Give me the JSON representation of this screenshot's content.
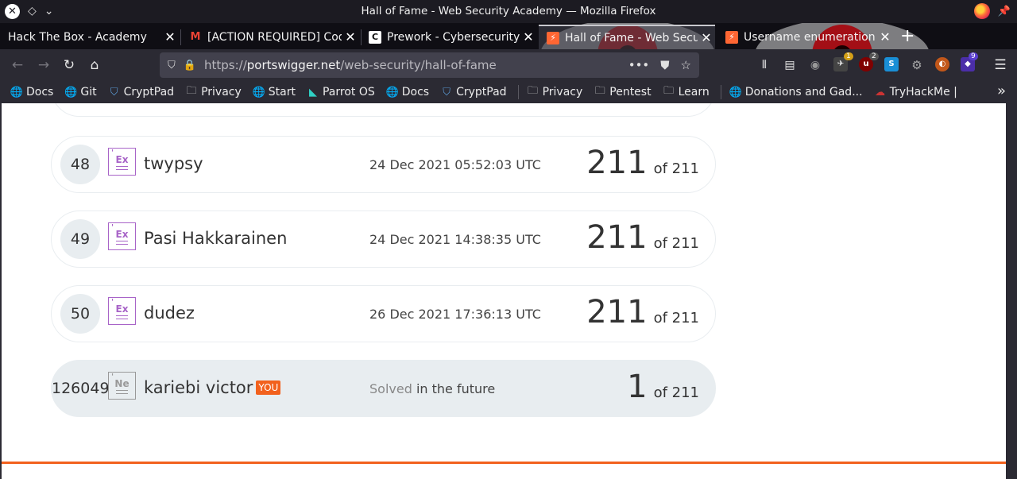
{
  "window": {
    "title": "Hall of Fame - Web Security Academy — Mozilla Firefox",
    "left_glyphs": [
      "◇",
      "⌄"
    ]
  },
  "tabs": [
    {
      "label": "Hack The Box - Academy",
      "favicon": "none"
    },
    {
      "label": "[ACTION REQUIRED] Code",
      "favicon": "gmail-icon"
    },
    {
      "label": "Prework - Cybersecurity",
      "favicon": "codepath-icon"
    },
    {
      "label": "Hall of Fame - Web Secu",
      "favicon": "portswigger-icon",
      "active": true
    },
    {
      "label": "Username enumeration",
      "favicon": "portswigger-icon"
    }
  ],
  "nav": {
    "url_prefix": "https://",
    "url_domain": "portswigger.net",
    "url_path": "/web-security/hall-of-fame",
    "more_glyph": "•••",
    "extension_badges": {
      "a": "1",
      "b": "2",
      "c": "9"
    }
  },
  "bookmarks": [
    {
      "label": "Docs",
      "icon": "globe-icon"
    },
    {
      "label": "Git",
      "icon": "globe-icon"
    },
    {
      "label": "CryptPad",
      "icon": "shield-icon"
    },
    {
      "label": "Privacy",
      "icon": "folder-icon"
    },
    {
      "label": "Start",
      "icon": "globe-icon"
    },
    {
      "label": "Parrot OS",
      "icon": "parrot-icon"
    },
    {
      "label": "Docs",
      "icon": "globe-icon"
    },
    {
      "label": "CryptPad",
      "icon": "shield-icon"
    },
    {
      "label": "Privacy",
      "icon": "folder-icon"
    },
    {
      "label": "Pentest",
      "icon": "folder-icon"
    },
    {
      "label": "Learn",
      "icon": "folder-icon"
    },
    {
      "label": "Donations and Gad...",
      "icon": "globe-icon"
    },
    {
      "label": "TryHackMe |",
      "icon": "tryhackme-icon"
    }
  ],
  "leaderboard": {
    "rows": [
      {
        "rank": "48",
        "badge": "Ex",
        "name": "twypsy",
        "date": "24 Dec 2021 05:52:03 UTC",
        "score": "211",
        "of": "of 211"
      },
      {
        "rank": "49",
        "badge": "Ex",
        "name": "Pasi Hakkarainen",
        "date": "24 Dec 2021 14:38:35 UTC",
        "score": "211",
        "of": "of 211"
      },
      {
        "rank": "50",
        "badge": "Ex",
        "name": "dudez",
        "date": "26 Dec 2021 17:36:13 UTC",
        "score": "211",
        "of": "of 211"
      }
    ],
    "you": {
      "rank": "126049",
      "badge": "Ne",
      "name": "kariebi victor",
      "tag": "YOU",
      "solved_label": "Solved",
      "solved_when": " in the future",
      "score": "1",
      "of": "of 211"
    }
  },
  "colors": {
    "accent": "#f2611d",
    "badge_expert": "#a864c8",
    "badge_new": "#999999"
  }
}
